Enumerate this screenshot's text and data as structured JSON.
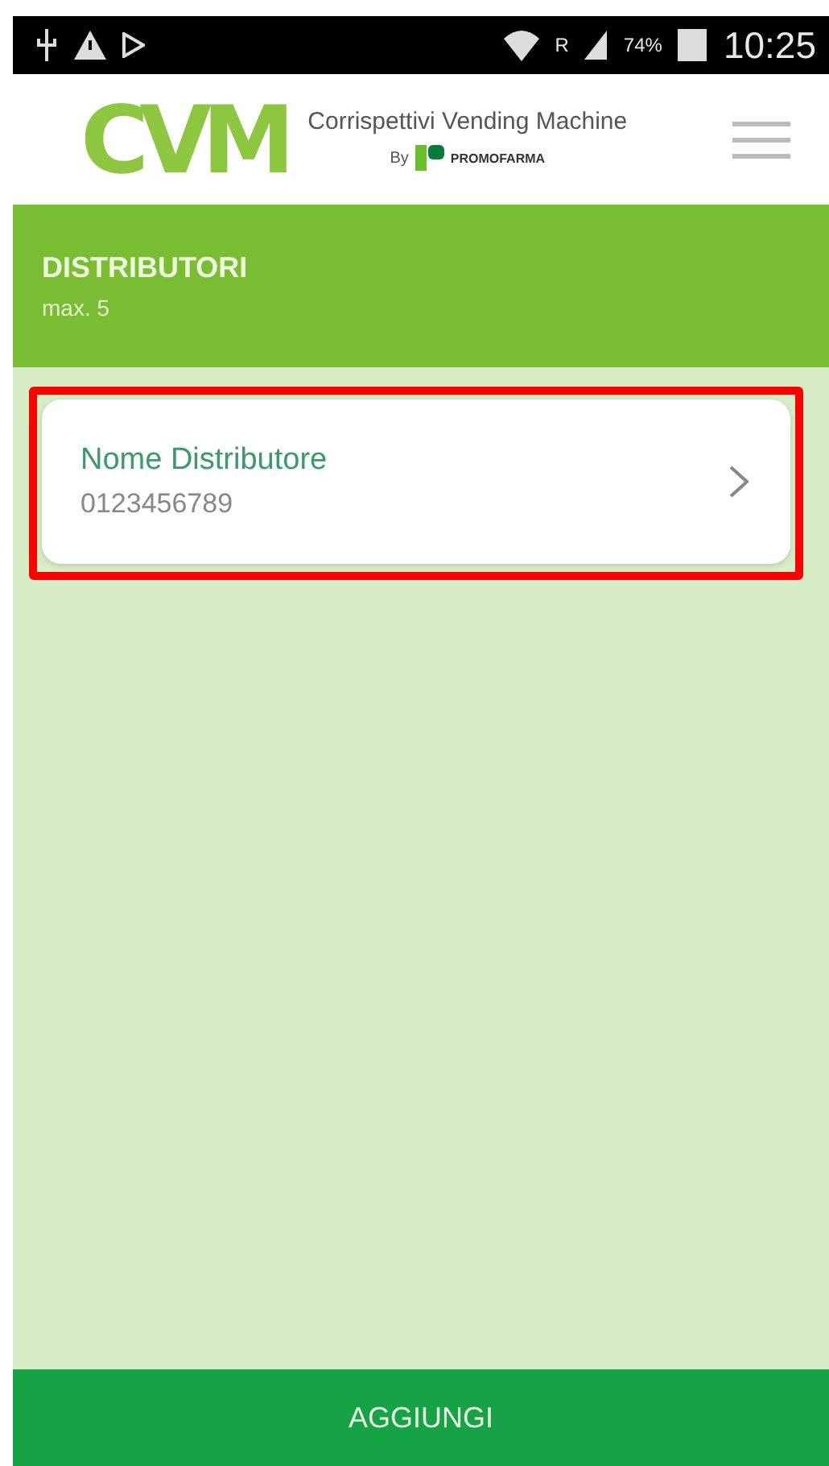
{
  "status_bar": {
    "roaming": "R",
    "battery": "74%",
    "time": "10:25"
  },
  "header": {
    "logo": "CVM",
    "tagline": "Corrispettivi Vending Machine",
    "by": "By",
    "brand": "PROMOFARMA"
  },
  "section": {
    "title": "DISTRIBUTORI",
    "subtitle": "max. 5"
  },
  "items": [
    {
      "name": "Nome Distributore",
      "code": "0123456789",
      "highlighted": true
    }
  ],
  "action_button": "AGGIUNGI"
}
